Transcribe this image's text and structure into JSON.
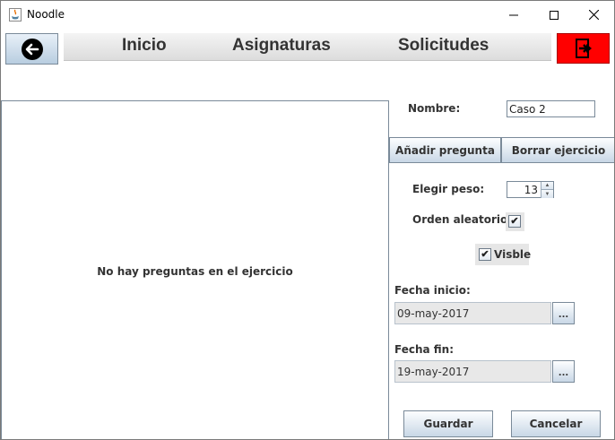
{
  "window": {
    "title": "Noodle"
  },
  "nav": {
    "back_icon": "arrow-left-icon",
    "items": [
      "Inicio",
      "Asignaturas",
      "Solicitudes"
    ],
    "exit_icon": "exit-door-icon",
    "exit_color": "#ff0000"
  },
  "questions": {
    "empty_message": "No hay preguntas en el ejercicio"
  },
  "form": {
    "name_label": "Nombre:",
    "name_value": "Caso 2",
    "add_question": "Añadir pregunta",
    "delete_exercise": "Borrar ejercicio",
    "weight_label": "Elegir peso:",
    "weight_value": "13",
    "random_order_label": "Orden aleatorio:",
    "random_order_checked": true,
    "visible_label": "Visble",
    "visible_checked": true,
    "start_date_label": "Fecha inicio:",
    "start_date_value": "09-may-2017",
    "end_date_label": "Fecha fin:",
    "end_date_value": "19-may-2017",
    "date_picker_label": "...",
    "save": "Guardar",
    "cancel": "Cancelar"
  }
}
